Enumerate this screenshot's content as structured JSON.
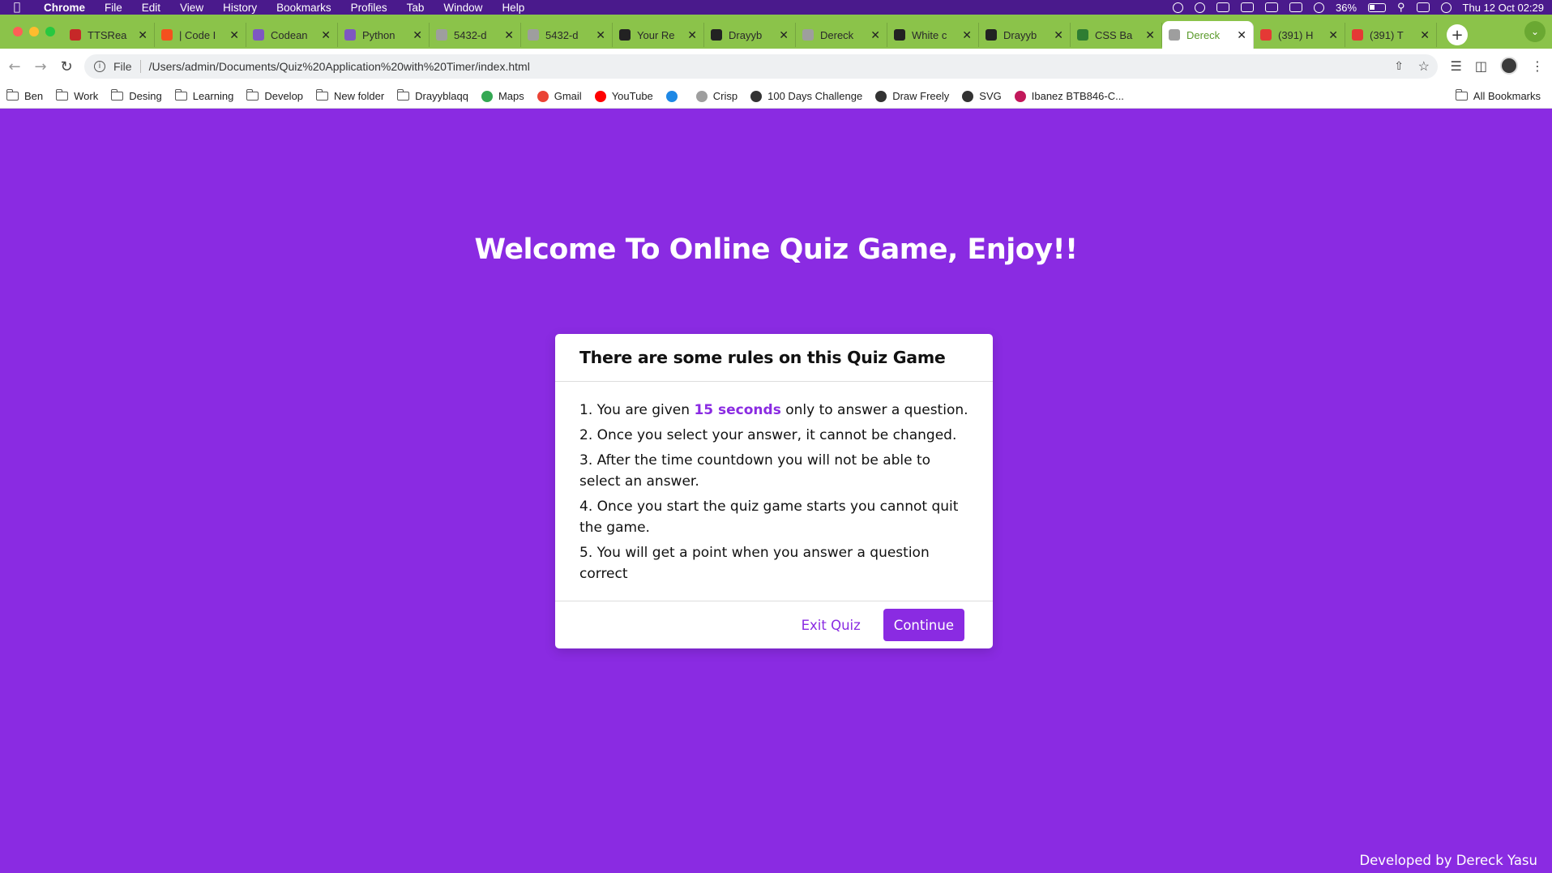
{
  "menubar": {
    "app": "Chrome",
    "items": [
      "File",
      "Edit",
      "View",
      "History",
      "Bookmarks",
      "Profiles",
      "Tab",
      "Window",
      "Help"
    ],
    "battery": "36%",
    "clock": "Thu 12 Oct  02:29"
  },
  "tabs": [
    {
      "label": "TTSRea",
      "favicon_color": "#c62828"
    },
    {
      "label": "| Code I",
      "favicon_color": "#f4511e"
    },
    {
      "label": "Codean",
      "favicon_color": "#7e57c2"
    },
    {
      "label": "Python",
      "favicon_color": "#7e57c2"
    },
    {
      "label": "5432-d",
      "favicon_color": "#9e9e9e"
    },
    {
      "label": "5432-d",
      "favicon_color": "#9e9e9e"
    },
    {
      "label": "Your Re",
      "favicon_color": "#222222"
    },
    {
      "label": "Drayyb",
      "favicon_color": "#222222"
    },
    {
      "label": "Dereck",
      "favicon_color": "#9e9e9e"
    },
    {
      "label": "White c",
      "favicon_color": "#222222"
    },
    {
      "label": "Drayyb",
      "favicon_color": "#222222"
    },
    {
      "label": "CSS Ba",
      "favicon_color": "#2e7d32"
    },
    {
      "label": "Dereck",
      "favicon_color": "#9e9e9e",
      "active": true
    },
    {
      "label": "(391) H",
      "favicon_color": "#e53935"
    },
    {
      "label": "(391) T",
      "favicon_color": "#e53935"
    }
  ],
  "address": {
    "scheme": "File",
    "url": "/Users/admin/Documents/Quiz%20Application%20with%20Timer/index.html"
  },
  "bookmarks": [
    {
      "label": "Ben",
      "icon": "folder-icon"
    },
    {
      "label": "Work",
      "icon": "folder-icon"
    },
    {
      "label": "Desing",
      "icon": "folder-icon"
    },
    {
      "label": "Learning",
      "icon": "folder-icon"
    },
    {
      "label": "Develop",
      "icon": "folder-icon"
    },
    {
      "label": "New folder",
      "icon": "folder-icon"
    },
    {
      "label": "Drayyblaqq",
      "icon": "folder-icon"
    },
    {
      "label": "Maps",
      "icon": "maps-icon",
      "color": "#34a853"
    },
    {
      "label": "Gmail",
      "icon": "gmail-icon",
      "color": "#ea4335"
    },
    {
      "label": "YouTube",
      "icon": "youtube-icon",
      "color": "#ff0000"
    },
    {
      "label": "",
      "icon": "app-icon",
      "color": "#1e88e5"
    },
    {
      "label": "Crisp",
      "icon": "crisp-icon",
      "color": "#9e9e9e"
    },
    {
      "label": "100 Days Challenge",
      "icon": "globe-icon",
      "color": "#333333"
    },
    {
      "label": "Draw Freely",
      "icon": "draw-icon",
      "color": "#333333"
    },
    {
      "label": "SVG",
      "icon": "globe-icon",
      "color": "#333333"
    },
    {
      "label": "Ibanez BTB846-C...",
      "icon": "bars-icon",
      "color": "#c2185b"
    }
  ],
  "bookmarks_right": "All Bookmarks",
  "page": {
    "heading": "Welcome To Online Quiz Game, Enjoy!!",
    "card": {
      "title": "There are some rules on this Quiz Game",
      "rule1_before": "1. You are given ",
      "rule1_highlight": "15 seconds",
      "rule1_after": " only to answer a question.",
      "rule2": "2. Once you select your answer, it cannot be changed.",
      "rule3": "3. After the time countdown you will not be able to select an answer.",
      "rule4": "4. Once you start the quiz game starts you cannot quit the game.",
      "rule5": "5. You will get a point when you answer a question correct",
      "exit_label": "Exit Quiz",
      "continue_label": "Continue"
    },
    "credit": "Developed by Dereck Yasu"
  },
  "colors": {
    "accent": "#8a2be2",
    "tabstrip": "#8bc34a"
  }
}
